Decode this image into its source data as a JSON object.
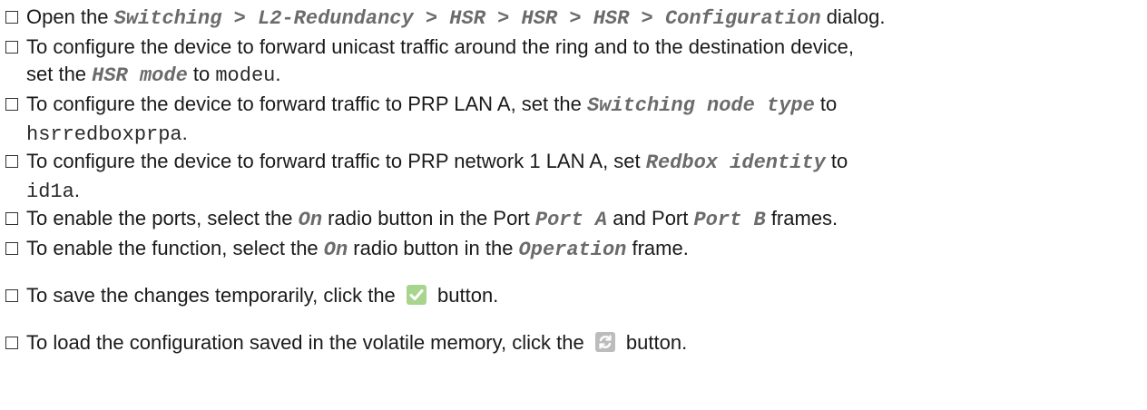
{
  "steps": [
    {
      "t1": "Open the ",
      "path": "Switching > L2-Redundancy > HSR > HSR > HSR > Configuration",
      "t2": " dialog."
    },
    {
      "t1": "To configure the device to forward unicast traffic around the ring and to the destination device,",
      "t2": "set the ",
      "ui": "HSR mode",
      "t3": " to ",
      "val": "modeu",
      "t4": "."
    },
    {
      "t1": "To configure the device to forward traffic to PRP LAN A, set the ",
      "ui": "Switching node type",
      "t2": " to",
      "val": "hsrredboxprpa",
      "t3": "."
    },
    {
      "t1": "To configure the device to forward traffic to PRP network 1 LAN A, set ",
      "ui": "Redbox identity",
      "t2": " to",
      "val": "id1a",
      "t3": "."
    },
    {
      "t1": "To enable the ports, select the ",
      "ui1": "On",
      "t2": " radio button in the Port ",
      "ui2": "Port A",
      "t3": " and Port ",
      "ui3": "Port B",
      "t4": " frames."
    },
    {
      "t1": "To enable the function, select the ",
      "ui1": "On",
      "t2": " radio button in the ",
      "ui2": "Operation",
      "t3": " frame."
    },
    {
      "t1": "To save the changes temporarily, click the ",
      "t2": " button.",
      "icon": "checkmark-icon",
      "icon_color": "#a7d58e"
    },
    {
      "t1": "To load the configuration saved in the volatile memory, click the ",
      "t2": " button.",
      "icon": "reload-icon",
      "icon_color": "#bcbcbc"
    }
  ]
}
